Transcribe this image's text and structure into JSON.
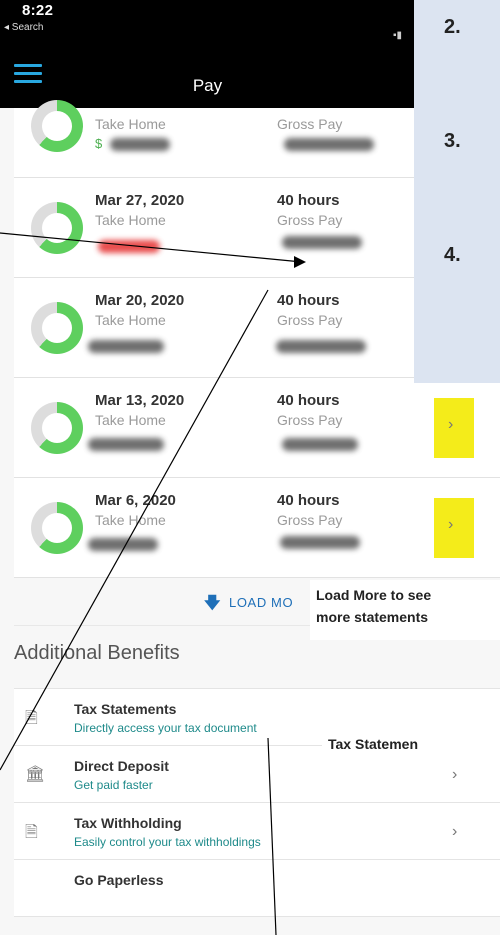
{
  "status_bar": {
    "time": "8:22",
    "back_label": "◂ Search"
  },
  "nav": {
    "title": "Pay"
  },
  "pay_statements": [
    {
      "date": "",
      "hours": "",
      "take_home_label": "Take Home",
      "gross_pay_label": "Gross Pay",
      "currency": "$"
    },
    {
      "date": "Mar 27, 2020",
      "hours": "40 hours",
      "take_home_label": "Take Home",
      "gross_pay_label": "Gross Pay"
    },
    {
      "date": "Mar 20, 2020",
      "hours": "40 hours",
      "take_home_label": "Take Home",
      "gross_pay_label": "Gross Pay"
    },
    {
      "date": "Mar 13, 2020",
      "hours": "40 hours",
      "take_home_label": "Take Home",
      "gross_pay_label": "Gross Pay"
    },
    {
      "date": "Mar 6, 2020",
      "hours": "40 hours",
      "take_home_label": "Take Home",
      "gross_pay_label": "Gross Pay"
    }
  ],
  "load_more": {
    "label": "LOAD MO"
  },
  "additional_benefits": {
    "title": "Additional Benefits",
    "items": [
      {
        "title": "Tax Statements",
        "subtitle": "Directly access your tax document",
        "icon": "document-icon"
      },
      {
        "title": "Direct Deposit",
        "subtitle": "Get paid faster",
        "icon": "bank-icon"
      },
      {
        "title": "Tax Withholding",
        "subtitle": "Easily control your tax withholdings",
        "icon": "document-icon"
      },
      {
        "title": "Go Paperless",
        "subtitle": "",
        "icon": "document-icon"
      }
    ]
  },
  "overlay": {
    "steps": [
      "2.",
      "3.",
      "4."
    ],
    "load_more_note": [
      "Load More to see",
      "more statements"
    ],
    "tax_note": "Tax Statemen"
  },
  "colors": {
    "ring_green": "#5ecf5e",
    "highlight_yellow": "#f4ec1a",
    "link_blue": "#1e6fb8",
    "nav_accent": "#29a8e0"
  }
}
